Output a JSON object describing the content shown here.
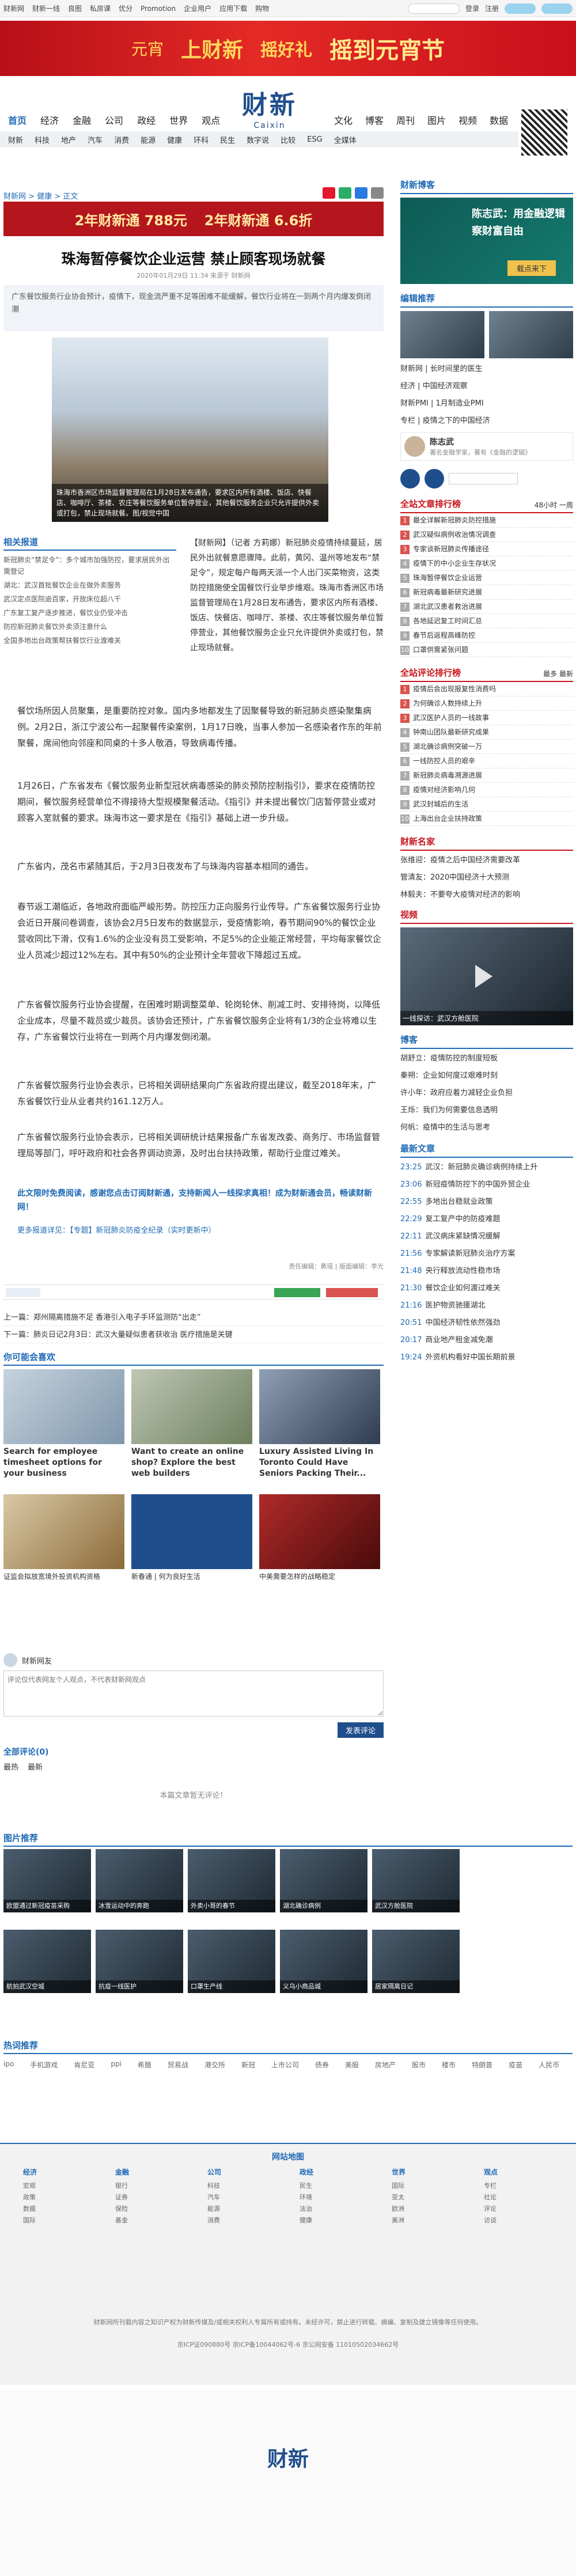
{
  "topbar": {
    "left": [
      "财新网",
      "财新一线",
      "良图",
      "私房课",
      "优分",
      "Promotion",
      "企业用户",
      "应用下载",
      "购物"
    ],
    "login": "登录",
    "register": "注册"
  },
  "banner": {
    "a": "上财新",
    "b": "摇好礼",
    "c": "摇到元宵节",
    "d": "元宵"
  },
  "logo": {
    "cn": "财新",
    "en": "Caixin"
  },
  "nav1": [
    "首页",
    "经济",
    "金融",
    "公司",
    "政经",
    "世界",
    "观点"
  ],
  "nav1b": [
    "文化",
    "博客",
    "周刊",
    "图片",
    "视频",
    "数据"
  ],
  "nav2": [
    "财新",
    "科技",
    "地产",
    "汽车",
    "消费",
    "能源",
    "健康",
    "环科",
    "民生",
    "数字说",
    "比较",
    "ESG",
    "全媒体"
  ],
  "crumb": "财新网 > 健康 > 正文",
  "ad_mid": {
    "a": "2年财新通 788元",
    "b": "2年财新通 6.6折"
  },
  "article": {
    "title": "珠海暂停餐饮企业运营 禁止顾客现场就餐",
    "meta": "2020年01月29日 11:34  来源于 财新网",
    "summary": "广东餐饮服务行业协会预计，疫情下，现金流严重不足等困难不能缓解，餐饮行业将在一到两个月内爆发倒闭潮",
    "photo_caption": "珠海市香洲区市场监督管理局在1月28日发布通告，要求区内所有酒楼、饭店、快餐店、咖啡厅、茶楼、农庄等餐饮服务单位暂停营业，其他餐饮服务企业只允许提供外卖或打包，禁止现场就餐。图/视觉中国",
    "lead": "【财新网】（记者 方莉娜）新冠肺炎疫情持续蔓延，居民外出就餐意愿骤降。此前，黄冈、温州等地发布“禁足令”，规定每户每两天派一个人出门买菜物资，这类防控措施使全国餐饮行业举步维艰。珠海市香洲区市场监督管理局在1月28日发布通告，要求区内所有酒楼、饭店、快餐店、咖啡厅、茶楼、农庄等餐饮服务单位暂停营业，其他餐饮服务企业只允许提供外卖或打包，禁止现场就餐。",
    "paragraphs": [
      "餐饮场所因人员聚集，是重要防控对象。国内多地都发生了因聚餐导致的新冠肺炎感染聚集病例。2月2日，浙江宁波公布一起聚餐传染案例，1月17日晚，当事人参加一名感染者作东的年前聚餐，席间他向邻座和同桌的十多人敬酒，导致病毒传播。",
      "1月26日，广东省发布《餐饮服务业新型冠状病毒感染的肺炎预防控制指引》，要求在疫情防控期间，餐饮服务经营单位不得接待大型规模聚餐活动。《指引》并未提出餐饮门店暂停营业或对顾客入室就餐的要求。珠海市这一要求是在《指引》基础上进一步升级。",
      "广东省内，茂名市紧随其后，于2月3日夜发布了与珠海内容基本相同的通告。",
      "春节返工潮临近，各地政府面临严峻形势。防控压力正向服务行业传导。广东省餐饮服务行业协会近日开展问卷调查，该协会2月5日发布的数据显示，受疫情影响，春节期间90%的餐饮企业营收同比下滑，仅有1.6%的企业没有员工受影响，不足5%的企业能正常经营，平均每家餐饮企业人员减少超过12%左右。其中有50%的企业预计全年营收下降超过五成。",
      "广东省餐饮服务行业协会提醒，在困难时期调整菜单、轮岗轮休、削减工时、安排待岗，以降低企业成本，尽量不裁员或少裁员。该协会还预计，广东省餐饮服务企业将有1/3的企业将难以生存，广东省餐饮行业将在一到两个月内爆发倒闭潮。",
      "广东省餐饮服务行业协会表示，已将相关调研结果向广东省政府提出建议，截至2018年末，广东省餐饮行业从业者共约161.12万人。",
      "广东省餐饮服务行业协会表示，已将相关调研统计结果报备广东省发改委、商务厅、市场监督管理局等部门，呼吁政府和社会各界调动资源，及时出台扶持政策，帮助行业度过难关。"
    ],
    "notice": "此文限时免费阅读，感谢您点击订阅财新通，支持新闻人一线探求真相！成为财新通会员，畅读财新网！",
    "more": "更多报道详见：【专题】新冠肺炎防疫全纪录（实时更新中）",
    "editor": "责任编辑：黄瑶 | 版面编辑：李光"
  },
  "related": {
    "title": "相关报道",
    "items": [
      "新冠肺炎“禁足令”：多个城市加强防控，要求居民外出需登记",
      "湖北：武汉首批餐饮企业在做外卖服务",
      "武汉定点医院逾百家，开放床位超八千",
      "广东复工复产逐步推进，餐饮业仍受冲击",
      "防控新冠肺炎餐饮外卖须注意什么",
      "全国多地出台政策帮扶餐饮行业渡难关"
    ]
  },
  "nav_prevnext": {
    "prev": "上一篇：郑州隔离措施不足 香港引入电子手环监测防“出走”",
    "next": "下一篇：肺炎日记2月3日：武汉大量疑似患者获收治 医疗措施是关键"
  },
  "recommend": {
    "title": "你可能会喜欢",
    "items": [
      "Search for employee timesheet options for your business",
      "Want to create an online shop? Explore the best web builders",
      "Luxury Assisted Living In Toronto Could Have Seniors Packing Their...",
      "证监会拟放宽境外投资机构资格",
      "新春通 | 何为良好生活",
      "中美需要怎样的战略稳定"
    ]
  },
  "comments": {
    "user": "财新网友",
    "placeholder": "评论仅代表网友个人观点，不代表财新网观点",
    "submit": "发表评论",
    "all": "全部评论(0)",
    "tabs": [
      "最热",
      "最新"
    ],
    "empty": "本篇文章暂无评论！"
  },
  "photo_rec": {
    "title": "图片推荐",
    "row1": [
      "欧盟通过新冠疫苗采购",
      "冰雪运动中的奔跑",
      "外卖小哥的春节",
      "湖北确诊病例",
      "武汉方舱医院"
    ],
    "row2": [
      "航拍武汉空城",
      "抗疫一线医护",
      "口罩生产线",
      "义乌小商品城",
      "居家隔离日记"
    ]
  },
  "hotwords": {
    "title": "热词推荐",
    "items": [
      "ipo",
      "手机游戏",
      "肯尼亚",
      "ppi",
      "希腊",
      "贸易战",
      "港交所",
      "新冠",
      "上市公司",
      "债券",
      "美股",
      "房地产",
      "股市",
      "楼市",
      "特朗普",
      "疫苗",
      "人民币"
    ]
  },
  "sidebar": {
    "blog_title": "财新博客",
    "ad": {
      "line1": "陈志武：用金融逻辑察财富自由",
      "btn": "载点来下"
    },
    "edit_title": "编辑推荐",
    "edit_items": [
      "财新网 | 长时间里的医生",
      "经济 | 中国经济观察",
      "财新PMI | 1月制造业PMI",
      "专栏 | 疫情之下的中国经济"
    ],
    "expert": {
      "name": "陈志武",
      "desc": "著名金融学家，著有《金融的逻辑》"
    },
    "rank_title": "全站文章排行榜",
    "rank_tabs": [
      "48小时",
      "一周"
    ],
    "rank": [
      "最全详解新冠肺炎防控措施",
      "武汉疑似病例收治情况调查",
      "专家谈新冠肺炎传播途径",
      "疫情下的中小企业生存状况",
      "珠海暂停餐饮企业运营",
      "新冠病毒最新研究进展",
      "湖北武汉患者救治进展",
      "各地延迟复工时间汇总",
      "春节后返程高峰防控",
      "口罩供需紧张问题"
    ],
    "comment_rank_title": "全站评论排行榜",
    "comment_tabs": [
      "最多",
      "最新"
    ],
    "crank": [
      "疫情后会出现报复性消费吗",
      "为何确诊人数持续上升",
      "武汉医护人员的一线故事",
      "钟南山团队最新研究成果",
      "湖北确诊病例突破一万",
      "一线防控人员的艰辛",
      "新冠肺炎病毒溯源进展",
      "疫情对经济影响几何",
      "武汉封城后的生活",
      "上海出台企业扶持政策"
    ],
    "columnist_title": "财新名家",
    "columnists": [
      "张维迎：疫情之后中国经济需要改革",
      "管清友：2020中国经济十大预测",
      "林毅夫：不要夸大疫情对经济的影响"
    ],
    "video_title": "视频",
    "video_caption": "一线探访：武汉方舱医院",
    "blog2_title": "博客",
    "blogs": [
      "胡舒立：疫情防控的制度短板",
      "秦朔：企业如何度过艰难时刻",
      "许小年：政府应着力减轻企业负担",
      "王烁：我们为何需要信息透明",
      "何帆：疫情中的生活与思考"
    ],
    "latest_title": "最新文章",
    "latest": [
      {
        "time": "23:25",
        "text": "武汉：新冠肺炎确诊病例持续上升"
      },
      {
        "time": "23:06",
        "text": "新冠疫情防控下的中国外贸企业"
      },
      {
        "time": "22:55",
        "text": "多地出台稳就业政策"
      },
      {
        "time": "22:29",
        "text": "复工复产中的防疫难题"
      },
      {
        "time": "22:11",
        "text": "武汉病床紧缺情况缓解"
      },
      {
        "time": "21:56",
        "text": "专家解读新冠肺炎治疗方案"
      },
      {
        "time": "21:48",
        "text": "央行释放流动性稳市场"
      },
      {
        "time": "21:30",
        "text": "餐饮企业如何渡过难关"
      },
      {
        "time": "21:16",
        "text": "医护物资驰援湖北"
      },
      {
        "time": "20:51",
        "text": "中国经济韧性依然强劲"
      },
      {
        "time": "20:17",
        "text": "商业地产租金减免潮"
      },
      {
        "time": "19:24",
        "text": "外资机构看好中国长期前景"
      }
    ]
  },
  "footer": {
    "title": "网站地图",
    "cols": [
      {
        "h": "经济",
        "items": [
          "宏观",
          "政策",
          "数据",
          "国际"
        ]
      },
      {
        "h": "金融",
        "items": [
          "银行",
          "证券",
          "保险",
          "基金"
        ]
      },
      {
        "h": "公司",
        "items": [
          "科技",
          "汽车",
          "能源",
          "消费"
        ]
      },
      {
        "h": "政经",
        "items": [
          "民生",
          "环境",
          "法治",
          "健康"
        ]
      },
      {
        "h": "世界",
        "items": [
          "国际",
          "亚太",
          "欧洲",
          "美洲"
        ]
      },
      {
        "h": "观点",
        "items": [
          "专栏",
          "社论",
          "评论",
          "访谈"
        ]
      }
    ],
    "copyright": "财新网所刊载内容之知识产权为财新传媒及/或相关权利人专属所有或持有。未经许可，禁止进行转载、摘编、复制及建立镜像等任何使用。",
    "icp": "京ICP证090880号 京ICP备10044062号-6 京公网安备 11010502034662号"
  }
}
